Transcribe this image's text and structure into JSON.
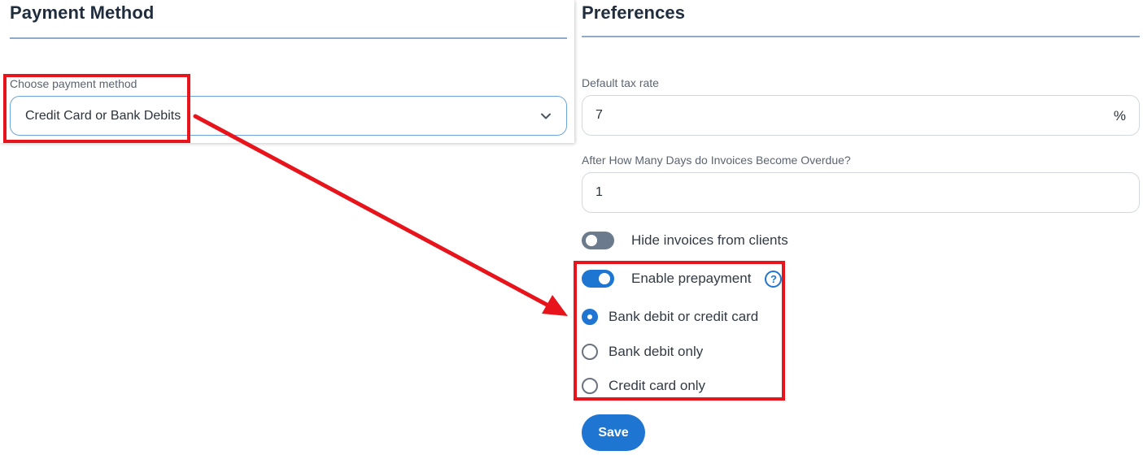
{
  "payment_method": {
    "title": "Payment Method",
    "choose_label": "Choose payment method",
    "selected": "Credit Card or Bank Debits"
  },
  "preferences": {
    "title": "Preferences",
    "tax_label": "Default tax rate",
    "tax_value": "7",
    "tax_suffix": "%",
    "overdue_label": "After How Many Days do Invoices Become Overdue?",
    "overdue_value": "1",
    "hide_invoices": {
      "label": "Hide invoices from clients",
      "on": false
    },
    "enable_prepayment": {
      "label": "Enable prepayment",
      "on": true,
      "help_glyph": "?"
    },
    "prepayment_options": [
      {
        "label": "Bank debit or credit card",
        "checked": true
      },
      {
        "label": "Bank debit only",
        "checked": false
      },
      {
        "label": "Credit card only",
        "checked": false
      }
    ],
    "save_label": "Save"
  },
  "colors": {
    "accent": "#1f76d2",
    "annotation": "#e8141c",
    "section_rule": "#8fa9c8"
  },
  "icons": [
    "chevron-down-icon",
    "help-icon"
  ]
}
